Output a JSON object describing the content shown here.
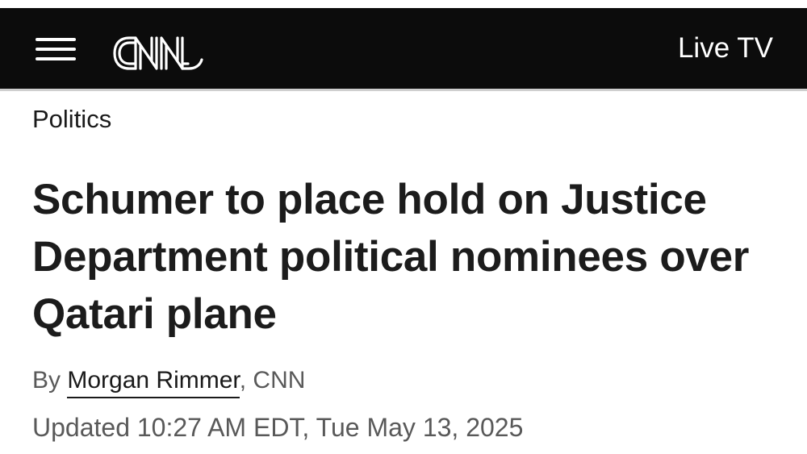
{
  "nav": {
    "menu_icon": "hamburger-menu-icon",
    "logo": "CNN",
    "live_tv": "Live TV",
    "background": "#0c0c0c"
  },
  "article": {
    "section": "Politics",
    "headline": "Schumer to place hold on Justice Department political nominees over Qatari plane",
    "byline": {
      "prefix": "By",
      "author": "Morgan Rimmer",
      "suffix": ", CNN"
    },
    "timestamp": "Updated 10:27 AM EDT, Tue May 13, 2025"
  }
}
